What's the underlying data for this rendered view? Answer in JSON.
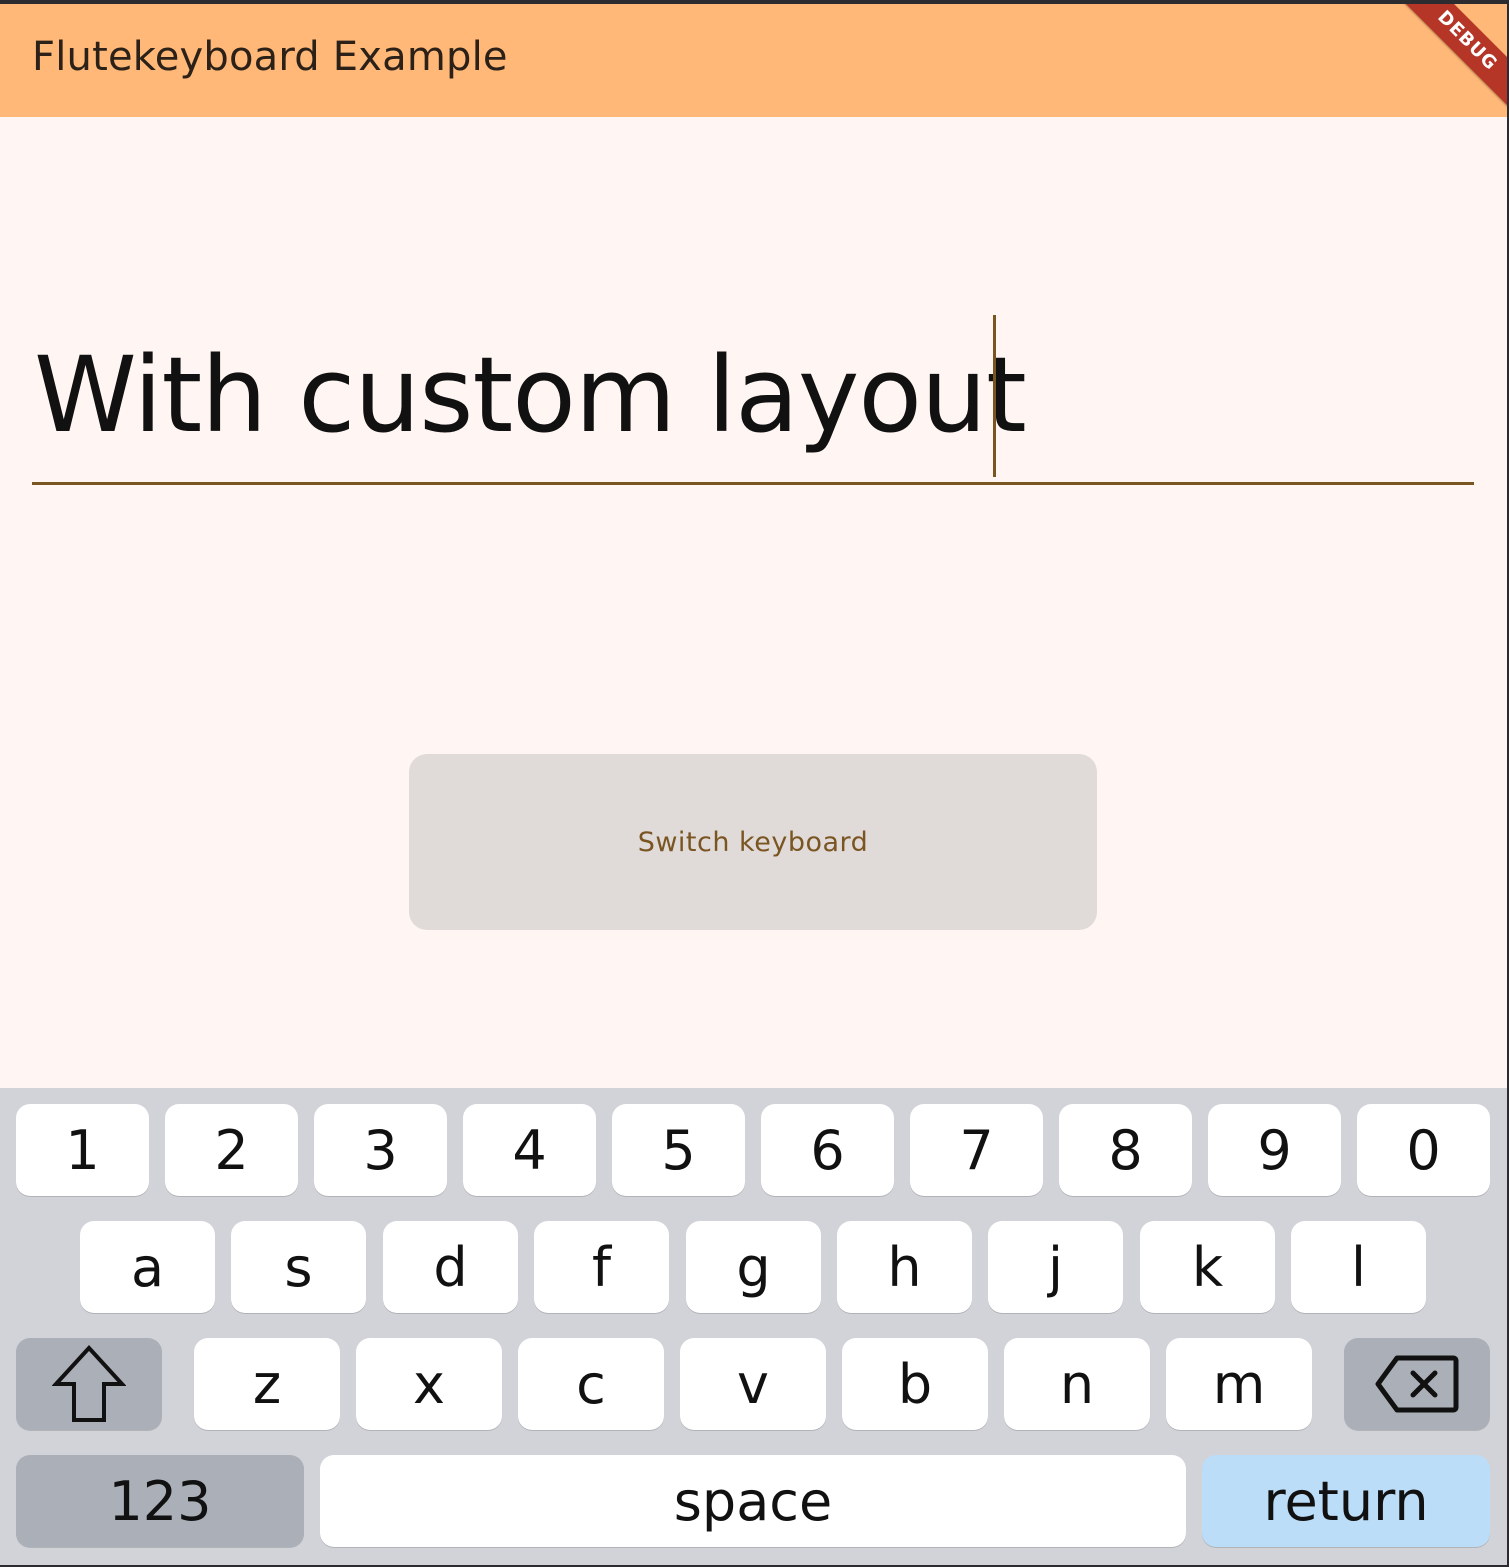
{
  "app_bar": {
    "title": "Flutekeyboard Example",
    "debug_banner": "DEBUG"
  },
  "text_field": {
    "value": "With custom layout"
  },
  "switch_button": {
    "label": "Switch keyboard"
  },
  "keyboard": {
    "number_row": [
      "1",
      "2",
      "3",
      "4",
      "5",
      "6",
      "7",
      "8",
      "9",
      "0"
    ],
    "home_row": [
      "a",
      "s",
      "d",
      "f",
      "g",
      "h",
      "j",
      "k",
      "l"
    ],
    "bottom_letter_row": [
      "z",
      "x",
      "c",
      "v",
      "b",
      "n",
      "m"
    ],
    "shift_icon": "shift-arrow-icon",
    "backspace_icon": "backspace-icon",
    "mode_label": "123",
    "space_label": "space",
    "return_label": "return"
  },
  "colors": {
    "app_bar": "#ffb877",
    "background": "#fff6f3",
    "accent": "#7a5522",
    "keyboard_background": "#d1d3d8",
    "key": "#ffffff",
    "special_key": "#abb0b8",
    "return_key": "#bcddf7",
    "debug_banner": "#b53527"
  }
}
